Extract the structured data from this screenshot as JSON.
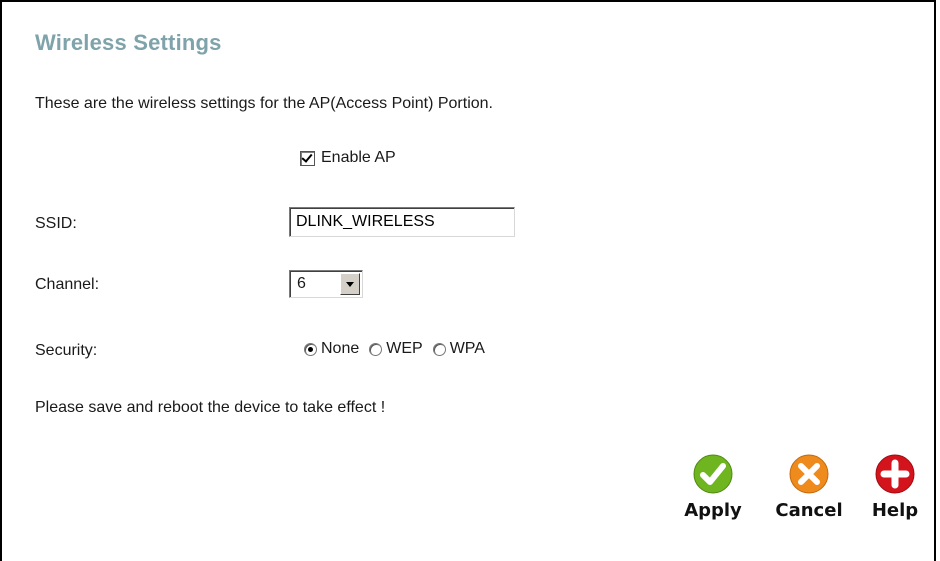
{
  "page": {
    "title": "Wireless Settings",
    "intro": "These are the wireless settings for the AP(Access Point) Portion."
  },
  "form": {
    "enable_ap_label": "Enable AP",
    "enable_ap_checked": true,
    "ssid_label": "SSID:",
    "ssid_value": "DLINK_WIRELESS",
    "channel_label": "Channel:",
    "channel_value": "6",
    "security_label": "Security:",
    "security_options": [
      "None",
      "WEP",
      "WPA"
    ],
    "security_selected": "None"
  },
  "note": "Please save and reboot the device to take effect !",
  "buttons": {
    "apply": "Apply",
    "cancel": "Cancel",
    "help": "Help"
  },
  "colors": {
    "title": "#7fa3aa",
    "apply": "#6fb51f",
    "cancel": "#ef8a1c",
    "help": "#d3141c"
  },
  "icons": {
    "apply": "check-icon",
    "cancel": "x-icon",
    "help": "plus-icon"
  }
}
